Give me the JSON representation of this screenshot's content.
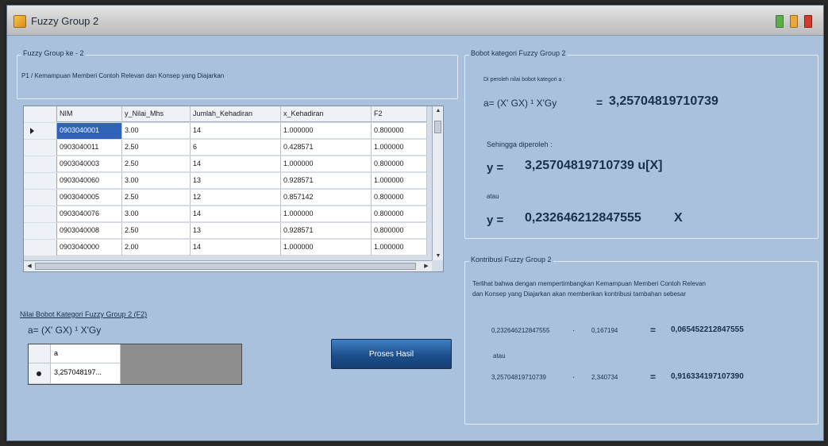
{
  "window": {
    "title": "Fuzzy Group 2"
  },
  "left": {
    "group_label": "Fuzzy Group ke - 2",
    "description": "P1 / Kemampuan Memberi Contoh Relevan dan Konsep yang Diajarkan",
    "grid": {
      "columns": [
        "NIM",
        "y_Nilai_Mhs",
        "Jumlah_Kehadiran",
        "x_Kehadiran",
        "F2"
      ],
      "rows": [
        [
          "0903040001",
          "3.00",
          "14",
          "1.000000",
          "0.800000"
        ],
        [
          "0903040011",
          "2.50",
          "6",
          "0.428571",
          "1.000000"
        ],
        [
          "0903040003",
          "2.50",
          "14",
          "1.000000",
          "0.800000"
        ],
        [
          "0903040060",
          "3.00",
          "13",
          "0.928571",
          "1.000000"
        ],
        [
          "0903040005",
          "2.50",
          "12",
          "0.857142",
          "0.800000"
        ],
        [
          "0903040076",
          "3.00",
          "14",
          "1.000000",
          "0.800000"
        ],
        [
          "0903040008",
          "2.50",
          "13",
          "0.928571",
          "0.800000"
        ],
        [
          "0903040000",
          "2.00",
          "14",
          "1.000000",
          "1.000000"
        ]
      ]
    },
    "nilai_label": "Nilai Bobot Kategori Fuzzy Group 2 (F2)",
    "formula": "a= (X' GX) ¹ X'Gy",
    "bobot_grid": {
      "header": "a",
      "value": "3,257048197..."
    },
    "proses_button": "Proses Hasil"
  },
  "right": {
    "bobot_group_label": "Bobot kategori Fuzzy Group 2",
    "diperoleh": "Di peroleh nilai bobot kategori a :",
    "a_formula": "a= (X' GX) ¹ X'Gy",
    "a_eq": "=",
    "a_value": "3,25704819710739",
    "sehingga": "Sehingga diperoleh :",
    "y1_prefix": "y =",
    "y1_value": "3,25704819710739 u[X]",
    "atau1": "atau",
    "y2_prefix": "y =",
    "y2_value": "0,232646212847555",
    "y2_suffix": "X",
    "kontribusi_label": "Kontribusi Fuzzy Group 2",
    "kontribusi_text1": "Terlihat bahwa dengan mempertimbangkan Kemampuan Memberi Contoh Relevan",
    "kontribusi_text2": "dan Konsep yang Diajarkan akan memberikan kontribusi tambahan sebesar",
    "k1": {
      "a": "0,232646212847555",
      "op": "·",
      "b": "0,167194",
      "eq": "=",
      "result": "0,065452212847555"
    },
    "atau2": "atau",
    "k2": {
      "a": "3,25704819710739",
      "op": "·",
      "b": "2,340734",
      "eq": "=",
      "result": "0,916334197107390"
    }
  }
}
